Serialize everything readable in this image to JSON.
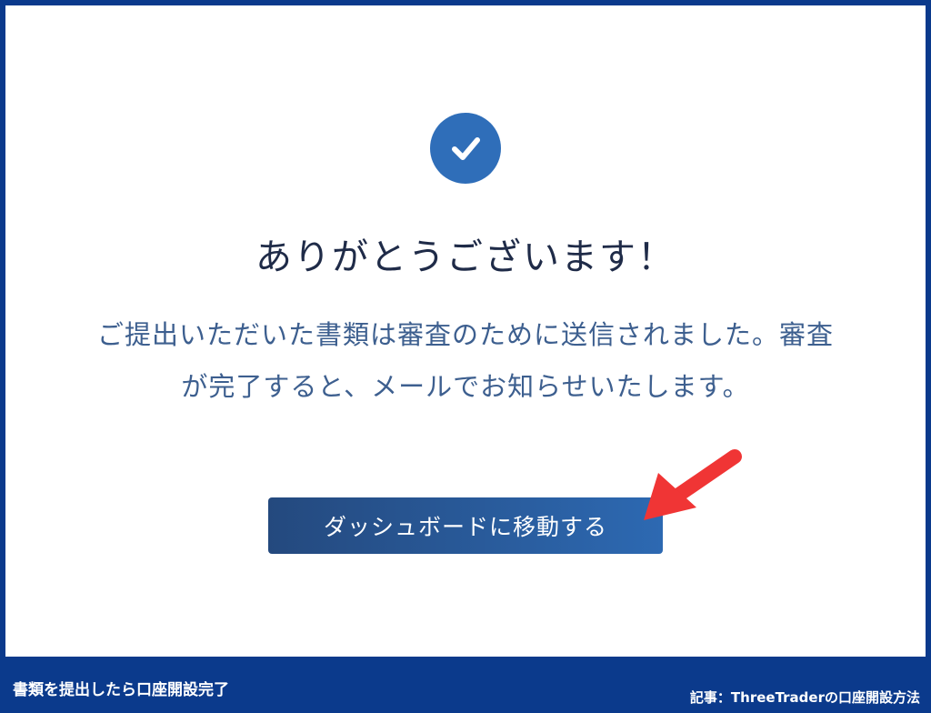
{
  "dialog": {
    "icon": "check-circle-icon",
    "title": "ありがとうございます！",
    "message": "ご提出いただいた書類は審査のために送信されました。審査が完了すると、メールでお知らせいたします。",
    "button_label": "ダッシュボードに移動する"
  },
  "annotation": {
    "arrow_icon": "red-arrow-icon",
    "arrow_color": "#f03535"
  },
  "footer": {
    "caption_left": "書類を提出したら口座開設完了",
    "caption_right": "記事：ThreeTraderの口座開設方法"
  },
  "colors": {
    "frame": "#0b3a8c",
    "accent": "#2f6eb9",
    "title_text": "#1f2b48",
    "message_text": "#3d5f8f"
  }
}
